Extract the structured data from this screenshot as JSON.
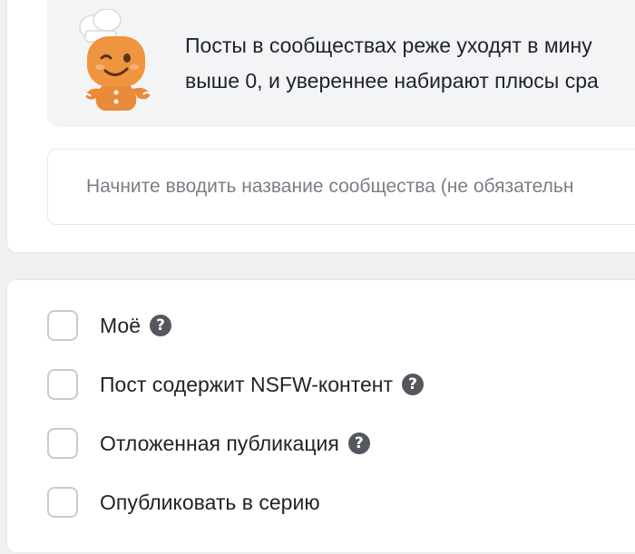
{
  "tip": {
    "line1": "Посты в сообществах реже уходят в мину",
    "line2": "выше 0, и увереннее набирают плюсы сра",
    "mascot_icon": "gingerbread-chef-icon"
  },
  "community_search": {
    "placeholder": "Начните вводить название сообщества (не обязательн"
  },
  "options": [
    {
      "label": "Моё",
      "has_help": true,
      "checked": false
    },
    {
      "label": "Пост содержит NSFW-контент",
      "has_help": true,
      "checked": false
    },
    {
      "label": "Отложенная публикация",
      "has_help": true,
      "checked": false
    },
    {
      "label": "Опубликовать в серию",
      "has_help": false,
      "checked": false
    }
  ],
  "help_glyph": "?"
}
